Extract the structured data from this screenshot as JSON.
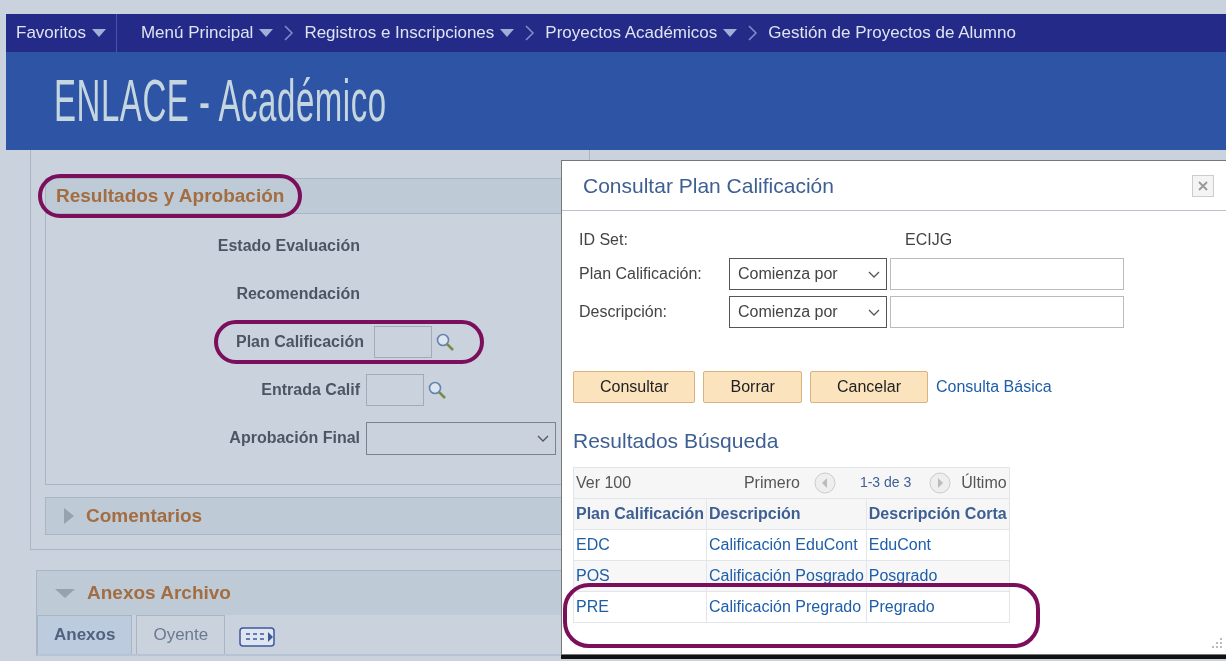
{
  "nav": [
    {
      "label": "Favoritos",
      "kind": "menu"
    },
    {
      "label": "Menú Principal",
      "kind": "menu"
    },
    {
      "label": "Registros e Inscripciones",
      "kind": "crumb_menu"
    },
    {
      "label": "Proyectos Académicos",
      "kind": "crumb_menu"
    },
    {
      "label": "Gestión de Proyectos de Alumno",
      "kind": "crumb"
    }
  ],
  "logo": {
    "text": "ENLACE - Académico"
  },
  "section": {
    "title": "Resultados y Aprobación",
    "highlighted": true,
    "fields": [
      {
        "label": "Estado Evaluación",
        "kind": "text",
        "highlighted": false
      },
      {
        "label": "Recomendación",
        "kind": "text",
        "highlighted": false
      },
      {
        "label": "Plan Calificación",
        "kind": "lookup",
        "highlighted": true
      },
      {
        "label": "Entrada Calif",
        "kind": "lookup",
        "highlighted": false
      },
      {
        "label": "Aprobación Final",
        "kind": "select",
        "highlighted": false
      }
    ]
  },
  "collapsibles": [
    {
      "title": "Comentarios",
      "expanded": false
    },
    {
      "title": "Anexos Archivo",
      "expanded": true
    }
  ],
  "tabs": [
    {
      "label": "Anexos",
      "selected": true
    },
    {
      "label": "Oyente",
      "selected": false
    }
  ],
  "modal": {
    "title": "Consultar Plan Calificación",
    "id_set": {
      "label": "ID Set:",
      "value": "ECIJG"
    },
    "criteria": [
      {
        "label": "Plan Calificación:",
        "operator": "Comienza por"
      },
      {
        "label": "Descripción:",
        "operator": "Comienza por"
      }
    ],
    "buttons": [
      "Consultar",
      "Borrar",
      "Cancelar"
    ],
    "link": "Consulta Básica",
    "results": {
      "title": "Resultados Búsqueda",
      "view": "Ver 100",
      "first": "Primero",
      "range": "1-3 de 3",
      "last": "Último",
      "columns": [
        "Plan Calificación",
        "Descripción",
        "Descripción Corta"
      ],
      "rows": [
        {
          "cells": [
            "EDC",
            "Calificación EduCont",
            "EduCont"
          ],
          "highlighted": false
        },
        {
          "cells": [
            "POS",
            "Calificación Posgrado",
            "Posgrado"
          ],
          "highlighted": false
        },
        {
          "cells": [
            "PRE",
            "Calificación Pregrado",
            "Pregrado"
          ],
          "highlighted": true
        }
      ]
    }
  }
}
